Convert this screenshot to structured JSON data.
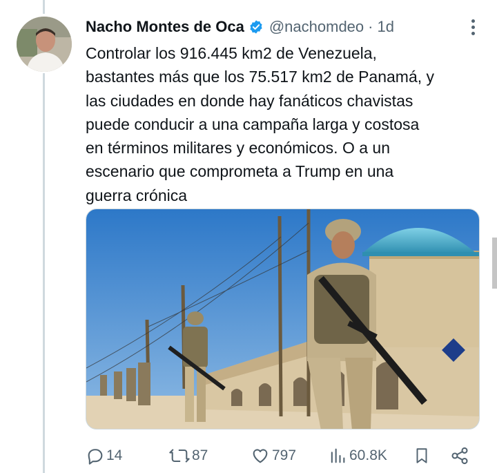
{
  "tweet": {
    "author_name": "Nacho Montes de Oca",
    "handle": "@nachomdeo",
    "separator": "·",
    "time": "1d",
    "text": "Controlar los 916.445 km2 de Venezuela,\nbastantes más que los 75.517 km2 de Panamá, y\nlas ciudades en donde hay fanáticos chavistas\npuede conducir a una campaña larga y costosa\nen términos militares y económicos. O a un\nescenario que comprometa a Trump en una\nguerra crónica"
  },
  "actions": {
    "replies": "14",
    "reposts": "87",
    "likes": "797",
    "views": "60.8K"
  },
  "icons": {
    "verified": "verified-badge-icon",
    "more": "more-vertical-icon",
    "reply": "reply-icon",
    "repost": "repost-icon",
    "like": "heart-icon",
    "views": "views-chart-icon",
    "bookmark": "bookmark-icon",
    "share": "share-icon"
  },
  "colors": {
    "verified": "#1d9bf0",
    "text": "#0f1419",
    "secondary": "#536471"
  }
}
